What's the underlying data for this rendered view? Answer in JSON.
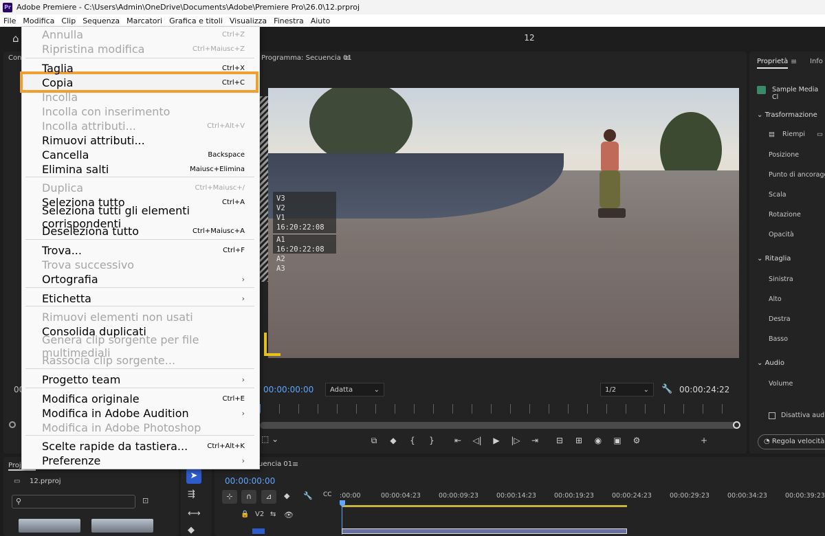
{
  "window": {
    "app_icon": "Pr",
    "title": "Adobe Premiere - C:\\Users\\Admin\\OneDrive\\Documents\\Adobe\\Premiere Pro\\26.0\\12.prproj"
  },
  "menubar": [
    "File",
    "Modifica",
    "Clip",
    "Sequenza",
    "Marcatori",
    "Grafica e titoli",
    "Visualizza",
    "Finestra",
    "Aiuto"
  ],
  "header": {
    "project_title": "12"
  },
  "left_panel": {
    "tab_partial": "Con",
    "tc_partial": "00"
  },
  "program_monitor": {
    "tab": "Programma: Secuencia 01",
    "timecode_current": "00:00:00:00",
    "timecode_duration": "00:00:24:22",
    "fit": "Adatta",
    "resolution": "1/2",
    "overlay_lines_video": [
      "V3",
      "V2",
      "V1 16:20:22:08"
    ],
    "overlay_lines_audio": [
      "A1 16:20:22:08",
      "A2",
      "A3"
    ]
  },
  "properties": {
    "tab_active": "Proprietà",
    "tab_other": "Info",
    "clip_name": "Sample Media Cl",
    "transform_title": "Trasformazione",
    "fill_label": "Riempi",
    "transform_items": [
      "Posizione",
      "Punto di ancoraggio",
      "Scala",
      "Rotazione",
      "Opacità"
    ],
    "crop_title": "Ritaglia",
    "crop_items": [
      "Sinistra",
      "Alto",
      "Destra",
      "Basso"
    ],
    "audio_title": "Audio",
    "volume_label": "Volume",
    "mute_label": "Disattiva audio",
    "speed_button": "Regola velocità"
  },
  "project": {
    "tab": "Proj",
    "file": "12.prproj"
  },
  "timeline": {
    "tab": "uencia 01",
    "timecode": "00:00:00:00",
    "ticks": [
      ":00:00",
      "00:00:04:23",
      "00:00:09:23",
      "00:00:14:23",
      "00:00:19:23",
      "00:00:24:23",
      "00:00:29:23",
      "00:00:34:23",
      "00:00:39:23"
    ],
    "track_v2": "V2"
  },
  "edit_menu": {
    "items": [
      {
        "label": "Annulla",
        "shortcut": "Ctrl+Z",
        "disabled": true
      },
      {
        "label": "Ripristina modifica",
        "shortcut": "Ctrl+Maiusc+Z",
        "disabled": true
      },
      {
        "label": "Taglia",
        "shortcut": "Ctrl+X",
        "disabled": false
      },
      {
        "label": "Copia",
        "shortcut": "Ctrl+C",
        "disabled": false
      },
      {
        "label": "Incolla",
        "shortcut": "",
        "disabled": true
      },
      {
        "label": "Incolla con inserimento",
        "shortcut": "",
        "disabled": true
      },
      {
        "label": "Incolla attributi...",
        "shortcut": "Ctrl+Alt+V",
        "disabled": true
      },
      {
        "label": "Rimuovi attributi...",
        "shortcut": "",
        "disabled": false
      },
      {
        "label": "Cancella",
        "shortcut": "Backspace",
        "disabled": false
      },
      {
        "label": "Elimina salti",
        "shortcut": "Maiusc+Elimina",
        "disabled": false
      },
      {
        "label": "Duplica",
        "shortcut": "Ctrl+Maiusc+/",
        "disabled": true
      },
      {
        "label": "Seleziona tutto",
        "shortcut": "Ctrl+A",
        "disabled": false
      },
      {
        "label": "Seleziona tutti gli elementi corrispondenti",
        "shortcut": "",
        "disabled": false
      },
      {
        "label": "Deseleziona tutto",
        "shortcut": "Ctrl+Maiusc+A",
        "disabled": false
      },
      {
        "label": "Trova...",
        "shortcut": "Ctrl+F",
        "disabled": false
      },
      {
        "label": "Trova successivo",
        "shortcut": "",
        "disabled": true
      },
      {
        "label": "Ortografia",
        "shortcut": "",
        "disabled": false,
        "submenu": true
      },
      {
        "label": "Etichetta",
        "shortcut": "",
        "disabled": false,
        "submenu": true
      },
      {
        "label": "Rimuovi elementi non usati",
        "shortcut": "",
        "disabled": true
      },
      {
        "label": "Consolida duplicati",
        "shortcut": "",
        "disabled": false
      },
      {
        "label": "Genera clip sorgente per file multimediali",
        "shortcut": "",
        "disabled": true
      },
      {
        "label": "Rassocia clip sorgente...",
        "shortcut": "",
        "disabled": true
      },
      {
        "label": "Progetto team",
        "shortcut": "",
        "disabled": false,
        "submenu": true
      },
      {
        "label": "Modifica originale",
        "shortcut": "Ctrl+E",
        "disabled": false
      },
      {
        "label": "Modifica in Adobe Audition",
        "shortcut": "",
        "disabled": false,
        "submenu": true
      },
      {
        "label": "Modifica in Adobe Photoshop",
        "shortcut": "",
        "disabled": true
      },
      {
        "label": "Scelte rapide da tastiera...",
        "shortcut": "Ctrl+Alt+K",
        "disabled": false
      },
      {
        "label": "Preferenze",
        "shortcut": "",
        "disabled": false,
        "submenu": true
      }
    ]
  },
  "colors": {
    "highlight_outline": "#f0a030",
    "accent_blue": "#5ea6ff",
    "timeline_bar": "#c7b43a"
  }
}
